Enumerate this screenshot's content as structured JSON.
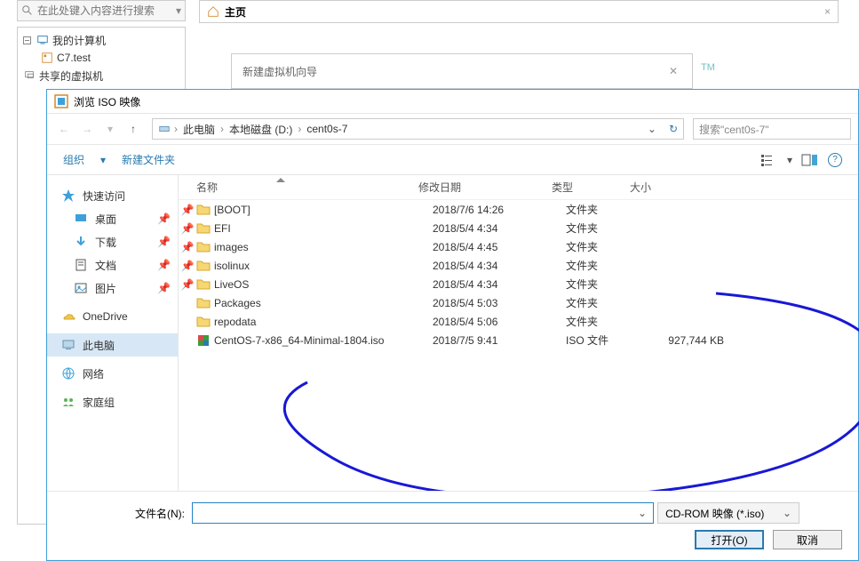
{
  "search_placeholder": "在此处键入内容进行搜索",
  "tree": {
    "root": "我的计算机",
    "vm": "C7.test",
    "shared": "共享的虚拟机"
  },
  "top_tab": "主页",
  "wizard_title": "新建虚拟机向导",
  "tm": "TM",
  "dialog": {
    "title": "浏览 ISO 映像",
    "breadcrumb": {
      "pc": "此电脑",
      "disk": "本地磁盘 (D:)",
      "folder": "cent0s-7"
    },
    "search_placeholder": "搜索\"cent0s-7\"",
    "organize": "组织",
    "new_folder": "新建文件夹",
    "sidebar": {
      "quick": "快速访问",
      "desktop": "桌面",
      "downloads": "下载",
      "documents": "文档",
      "pictures": "图片",
      "onedrive": "OneDrive",
      "thispc": "此电脑",
      "network": "网络",
      "homegroup": "家庭组"
    },
    "cols": {
      "name": "名称",
      "date": "修改日期",
      "type": "类型",
      "size": "大小"
    },
    "rows": [
      {
        "name": "[BOOT]",
        "date": "2018/7/6 14:26",
        "type": "文件夹",
        "size": "",
        "pin": true,
        "kind": "folder"
      },
      {
        "name": "EFI",
        "date": "2018/5/4 4:34",
        "type": "文件夹",
        "size": "",
        "pin": true,
        "kind": "folder"
      },
      {
        "name": "images",
        "date": "2018/5/4 4:45",
        "type": "文件夹",
        "size": "",
        "pin": true,
        "kind": "folder"
      },
      {
        "name": "isolinux",
        "date": "2018/5/4 4:34",
        "type": "文件夹",
        "size": "",
        "pin": true,
        "kind": "folder"
      },
      {
        "name": "LiveOS",
        "date": "2018/5/4 4:34",
        "type": "文件夹",
        "size": "",
        "pin": true,
        "kind": "folder"
      },
      {
        "name": "Packages",
        "date": "2018/5/4 5:03",
        "type": "文件夹",
        "size": "",
        "pin": false,
        "kind": "folder"
      },
      {
        "name": "repodata",
        "date": "2018/5/4 5:06",
        "type": "文件夹",
        "size": "",
        "pin": false,
        "kind": "folder"
      },
      {
        "name": "CentOS-7-x86_64-Minimal-1804.iso",
        "date": "2018/7/5 9:41",
        "type": "ISO 文件",
        "size": "927,744 KB",
        "pin": false,
        "kind": "iso"
      }
    ],
    "filename_label": "文件名(N):",
    "filter": "CD-ROM 映像 (*.iso)",
    "open": "打开(O)",
    "cancel": "取消"
  }
}
